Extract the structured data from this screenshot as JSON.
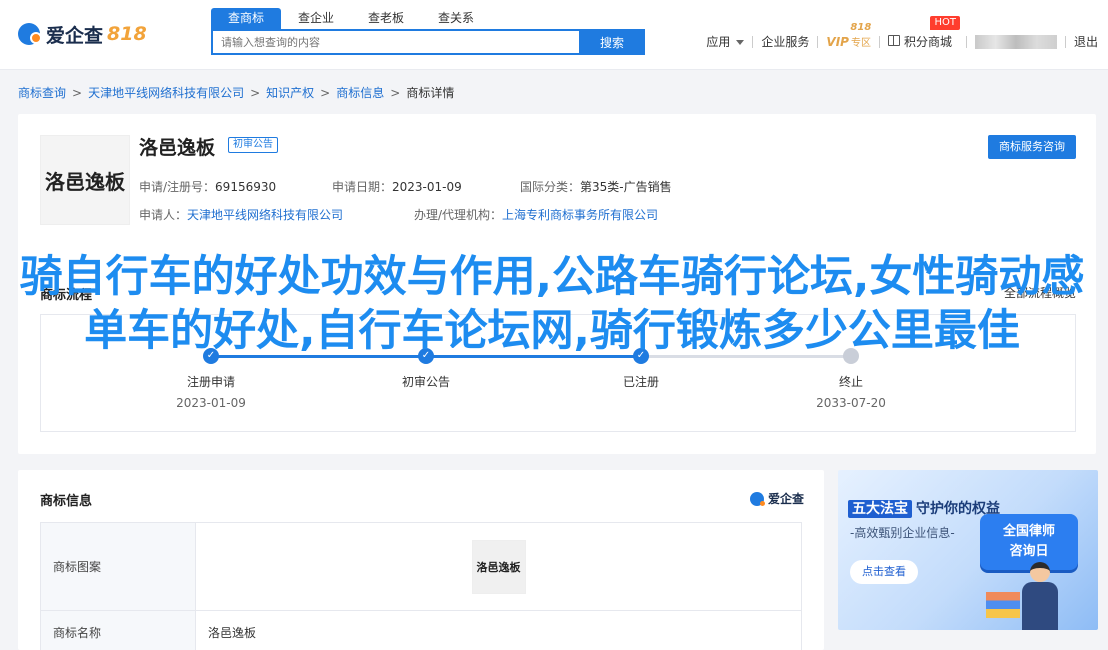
{
  "header": {
    "logo_text": "爱企查",
    "logo_818": "818",
    "search_tabs": [
      "查商标",
      "查企业",
      "查老板",
      "查关系"
    ],
    "search_placeholder": "请输入想查询的内容",
    "search_button": "搜索",
    "nav": {
      "app": "应用",
      "enterprise_service": "企业服务",
      "vip": "VIP",
      "vip_zone": "专区",
      "vip_818": "818",
      "points_mall": "积分商城",
      "hot": "HOT",
      "logout": "退出"
    }
  },
  "breadcrumb": [
    "商标查询",
    "天津地平线网络科技有限公司",
    "知识产权",
    "商标信息",
    "商标详情"
  ],
  "trademark": {
    "name": "洛邑逸板",
    "badge": "初审公告",
    "consult_button": "商标服务咨询",
    "reg_no_label": "申请/注册号：",
    "reg_no": "69156930",
    "apply_date_label": "申请日期：",
    "apply_date": "2023-01-09",
    "intl_class_label": "国际分类：",
    "intl_class": "第35类-广告销售",
    "applicant_label": "申请人：",
    "applicant": "天津地平线网络科技有限公司",
    "agent_label": "办理/代理机构：",
    "agent": "上海专利商标事务所有限公司"
  },
  "status": {
    "title": "商标流程",
    "overview": "全部流程概览",
    "steps": [
      {
        "label": "注册申请",
        "date": "2023-01-09"
      },
      {
        "label": "初审公告",
        "date": ""
      },
      {
        "label": "已注册",
        "date": ""
      },
      {
        "label": "终止",
        "date": "2033-07-20"
      }
    ],
    "progress_fraction": 0.67
  },
  "headline": "骑自行车的好处功效与作用,公路车骑行论坛,女性骑动感单车的好处,自行车论坛网,骑行锻炼多少公里最佳",
  "info": {
    "title": "商标信息",
    "brand": "爱企查",
    "rows": [
      {
        "key": "商标图案",
        "value": "洛邑逸板"
      },
      {
        "key": "商标名称",
        "value": "洛邑逸板"
      }
    ]
  },
  "ad": {
    "badge": "五大法宝",
    "title": "守护你的权益",
    "subtitle": "-高效甄别企业信息-",
    "button": "点击查看",
    "card_line1": "全国律师",
    "card_line2": "咨询日"
  },
  "colors": {
    "accent": "#1f7be0",
    "headline": "#1d8cf0",
    "link": "#1f6fd0",
    "hot": "#ff3d2e",
    "vip": "#e3a44a"
  }
}
